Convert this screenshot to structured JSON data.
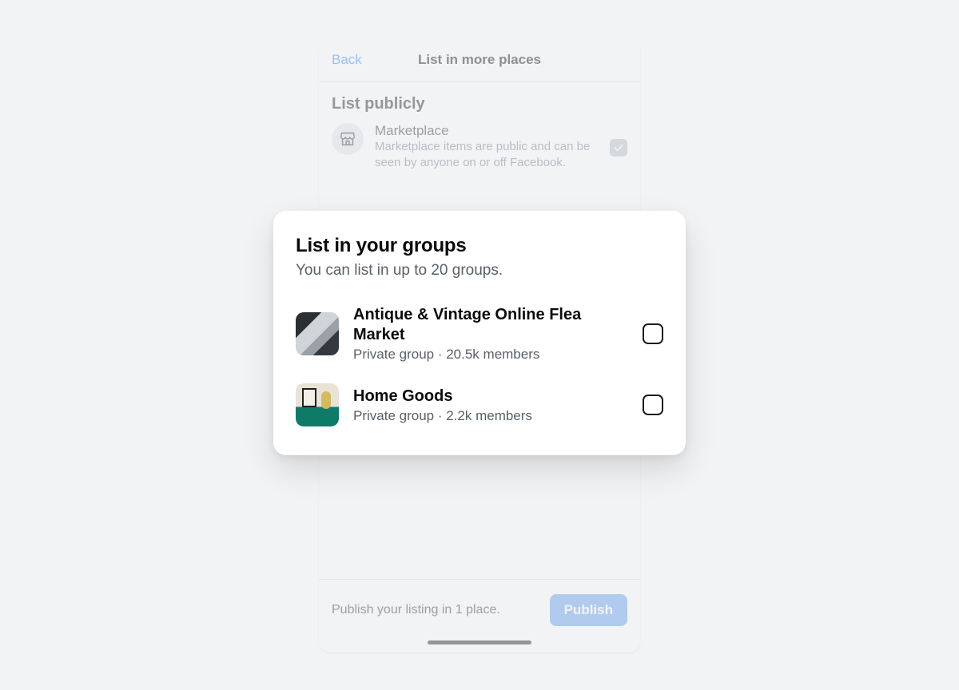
{
  "nav": {
    "back": "Back",
    "title": "List in more places"
  },
  "list_publicly": {
    "heading": "List publicly",
    "marketplace": {
      "name": "Marketplace",
      "description": "Marketplace items are public and can be seen by anyone on or off Facebook."
    }
  },
  "modal": {
    "title": "List in your groups",
    "subtitle": "You can list in up to 20 groups.",
    "groups": [
      {
        "name": "Antique & Vintage Online Flea Market",
        "meta": "Private group  ·  20.5k members"
      },
      {
        "name": "Home Goods",
        "meta": "Private group  ·  2.2k members"
      }
    ]
  },
  "footer": {
    "text": "Publish your listing in 1 place.",
    "button": "Publish"
  }
}
